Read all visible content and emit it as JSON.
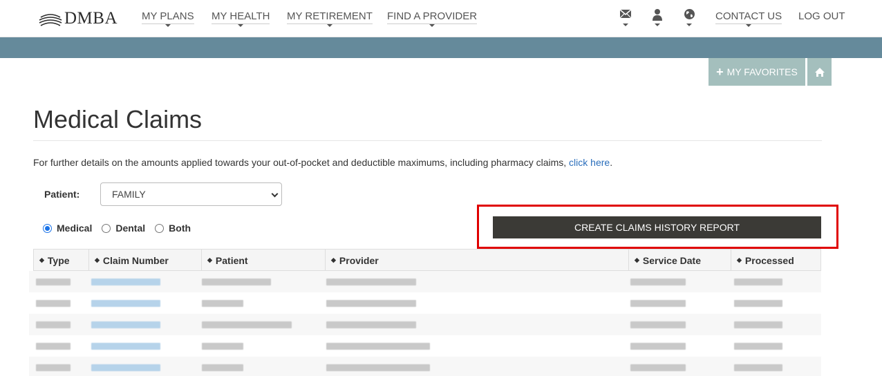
{
  "brand": {
    "name": "DMBA"
  },
  "nav": {
    "my_plans": "MY PLANS",
    "my_health": "MY HEALTH",
    "my_retirement": "MY RETIREMENT",
    "find_provider": "FIND A PROVIDER",
    "contact_us": "CONTACT US",
    "log_out": "LOG OUT",
    "icons": [
      "mail-icon",
      "user-icon",
      "globe-icon"
    ]
  },
  "favorites": {
    "label": "MY FAVORITES"
  },
  "page": {
    "title": "Medical Claims",
    "info_text": "For further details on the amounts applied towards your out-of-pocket and deductible maximums, including pharmacy claims, ",
    "info_link": "click here",
    "info_end": "."
  },
  "filters": {
    "patient_label": "Patient:",
    "patient_value": "FAMILY",
    "claim_types": [
      {
        "label": "Medical",
        "checked": true
      },
      {
        "label": "Dental",
        "checked": false
      },
      {
        "label": "Both",
        "checked": false
      }
    ]
  },
  "report_button": "CREATE CLAIMS HISTORY REPORT",
  "table": {
    "columns": [
      "Type",
      "Claim Number",
      "Patient",
      "Provider",
      "Service Date",
      "Processed"
    ],
    "row_count_visible": 5,
    "rows_redacted": true
  },
  "colors": {
    "banner": "#658a9b",
    "favorites_bg": "#a4bfbd",
    "report_button_bg": "#3b3a36",
    "highlight_outline": "#e00000",
    "link": "#2a6ebb"
  }
}
